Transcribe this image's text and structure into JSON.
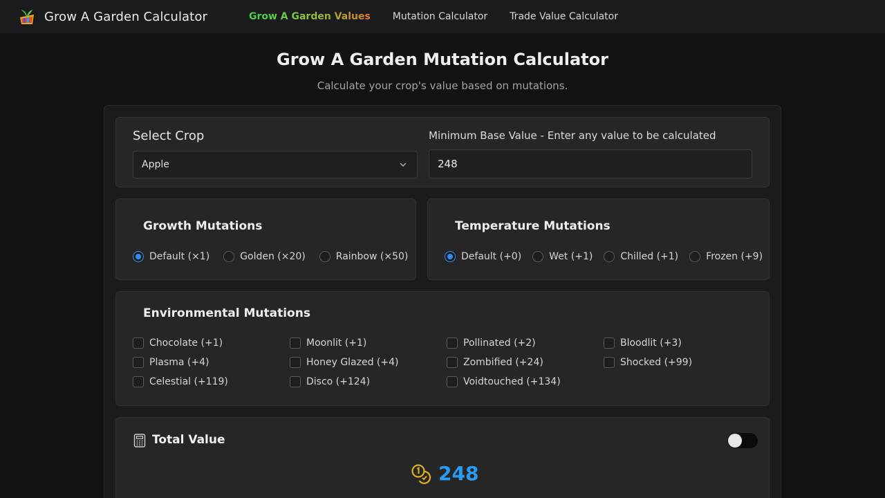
{
  "header": {
    "title": "Grow A Garden Calculator",
    "logo_icon": "garden-logo-icon",
    "nav": [
      {
        "label": "Grow A Garden Values",
        "active": true
      },
      {
        "label": "Mutation Calculator",
        "active": false
      },
      {
        "label": "Trade Value Calculator",
        "active": false
      }
    ]
  },
  "page": {
    "title": "Grow A Garden Mutation Calculator",
    "subtitle": "Calculate your crop's value based on mutations."
  },
  "crop": {
    "label": "Select Crop",
    "selected": "Apple",
    "base_label": "Minimum Base Value - Enter any value to be calculated",
    "base_value": "248"
  },
  "growth": {
    "title": "Growth Mutations",
    "options": [
      "Default (×1)",
      "Golden (×20)",
      "Rainbow (×50)"
    ],
    "selected_index": 0
  },
  "temperature": {
    "title": "Temperature Mutations",
    "options": [
      "Default (+0)",
      "Wet (+1)",
      "Chilled (+1)",
      "Frozen (+9)"
    ],
    "selected_index": 0
  },
  "environmental": {
    "title": "Environmental Mutations",
    "options": [
      "Chocolate (+1)",
      "Moonlit (+1)",
      "Pollinated (+2)",
      "Bloodlit (+3)",
      "Plasma (+4)",
      "Honey Glazed (+4)",
      "Zombified (+24)",
      "Shocked (+99)",
      "Celestial (+119)",
      "Disco (+124)",
      "Voidtouched (+134)"
    ]
  },
  "total": {
    "title": "Total Value",
    "value": "248",
    "toggle_on": false
  },
  "colors": {
    "accent": "#2f8cf0",
    "value_blue": "#2b9af0",
    "coin_gold": "#e0b020",
    "background": "#121213"
  }
}
